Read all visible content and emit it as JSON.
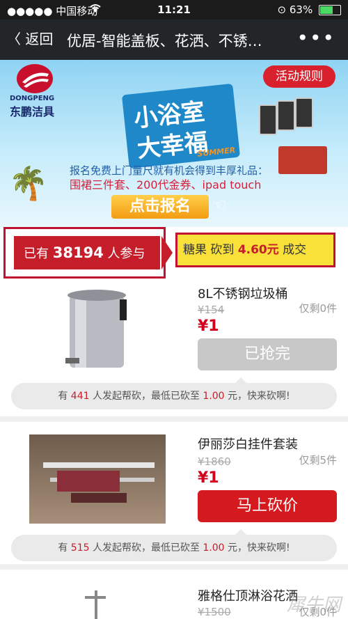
{
  "status_bar": {
    "signal": "●●●●● 中国移动",
    "wifi_icon": "wifi-icon",
    "time": "11:21",
    "battery": "63%",
    "battery_level": 0.63
  },
  "nav": {
    "back_label": "〈 返回",
    "title": "优居-智能盖板、花洒、不锈…",
    "more_label": "•••"
  },
  "banner": {
    "brand_en": "DONGPENG",
    "brand_cn": "东鹏洁具",
    "rules_button": "活动规则",
    "headline_1": "小浴室",
    "headline_2": "大幸福",
    "summer": "SUMMER",
    "promo_line1": "报名免费上门量尺就有机会得到丰厚礼品：",
    "promo_line2": "围裙三件套、200代金券、ipad touch",
    "signup_button": "点击报名"
  },
  "stats": {
    "prefix": "已有",
    "count": "38194",
    "suffix": "人参与",
    "deal_user": "糖果",
    "deal_mid": "砍到",
    "deal_price": "4.60元",
    "deal_suffix": "成交"
  },
  "products": [
    {
      "name": "8L不锈钢垃圾桶",
      "original_price": "¥154",
      "remaining": "仅剩0件",
      "current_price": "¥1",
      "button": "已抢完",
      "helpers_prefix": "有",
      "helpers_count": "441",
      "helpers_mid": "人发起帮砍，最低已砍至",
      "helpers_price": "1.00",
      "helpers_suffix": "元，快来砍啊!"
    },
    {
      "name": "伊丽莎白挂件套装",
      "original_price": "¥1860",
      "remaining": "仅剩5件",
      "current_price": "¥1",
      "button": "马上砍价",
      "helpers_prefix": "有",
      "helpers_count": "515",
      "helpers_mid": "人发起帮砍，最低已砍至",
      "helpers_price": "1.00",
      "helpers_suffix": "元，快来砍啊!"
    },
    {
      "name": "雅格仕顶淋浴花洒",
      "original_price": "¥1500",
      "remaining": "仅剩0件"
    }
  ],
  "watermark": "犀牛网"
}
